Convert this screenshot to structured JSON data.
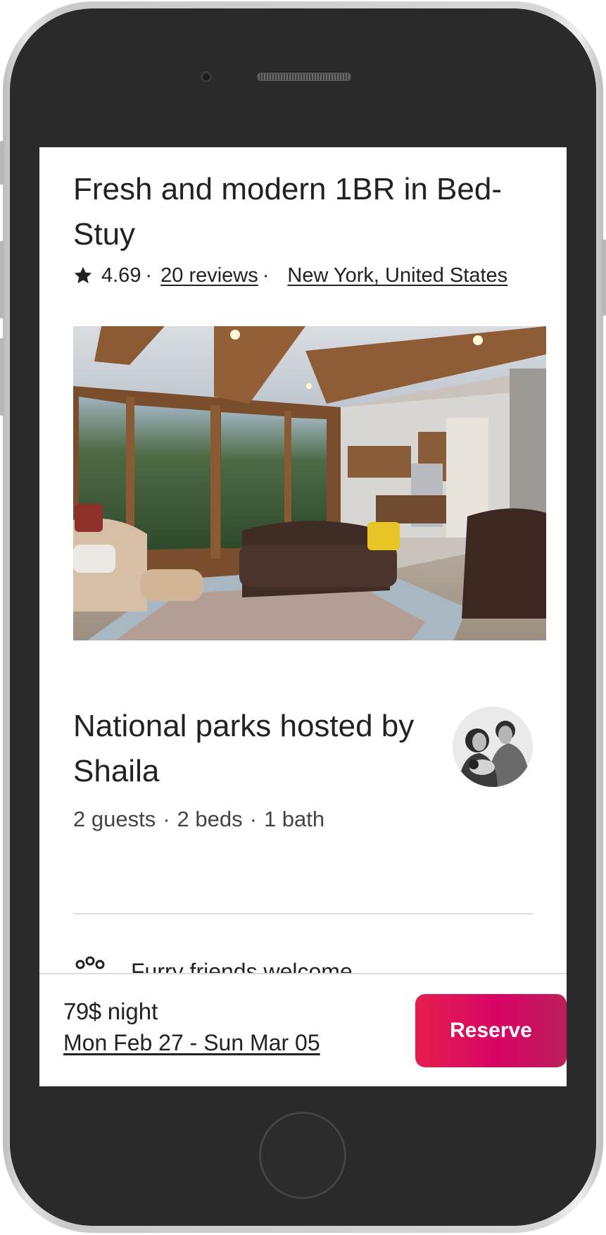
{
  "listing": {
    "title": "Fresh and modern 1BR in Bed-Stuy",
    "rating": "4.69",
    "reviews_link": "20 reviews",
    "location_link": "New York, United States",
    "separator": "·"
  },
  "host": {
    "title": "National parks hosted by Shaila",
    "specs": [
      "2 guests",
      "2 beds",
      "1 bath"
    ]
  },
  "amenity": {
    "label": "Furry friends welcome",
    "icon": "paw-icon"
  },
  "footer": {
    "price": "79$",
    "price_unit": "night",
    "dates": "Mon Feb 27 - Sun Mar 05",
    "reserve_label": "Reserve"
  },
  "colors": {
    "accent_start": "#e61e4d",
    "accent_end": "#bd1e59",
    "phone_body": "#2a2a2a"
  }
}
